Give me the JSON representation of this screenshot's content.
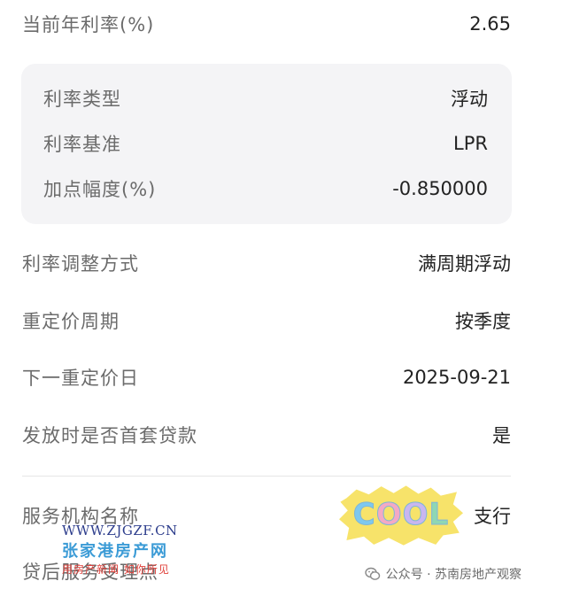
{
  "current_rate": {
    "label": "当前年利率(%)",
    "value": "2.65"
  },
  "rate_card": [
    {
      "label": "利率类型",
      "value": "浮动"
    },
    {
      "label": "利率基准",
      "value": "LPR"
    },
    {
      "label": "加点幅度(%)",
      "value": "-0.850000"
    }
  ],
  "details": [
    {
      "label": "利率调整方式",
      "value": "满周期浮动"
    },
    {
      "label": "重定价周期",
      "value": "按季度"
    },
    {
      "label": "下一重定价日",
      "value": "2025-09-21"
    },
    {
      "label": "发放时是否首套贷款",
      "value": "是"
    }
  ],
  "service_org": {
    "label": "服务机构名称",
    "value_visible": "支行"
  },
  "after_service": {
    "label": "贷后服务受理点"
  },
  "sticker": {
    "text": "COOL"
  },
  "watermark": {
    "url": "WWW.ZJGZF.CN",
    "name": "张家港房产网",
    "slogan": "用房产新闻 如你所见"
  },
  "official_account": {
    "text": "公众号 · 苏南房地产观察",
    "icon": "wechat-icon"
  },
  "colors": {
    "card_bg": "#f4f4f6",
    "label": "#6b6b6b",
    "value": "#222222"
  }
}
